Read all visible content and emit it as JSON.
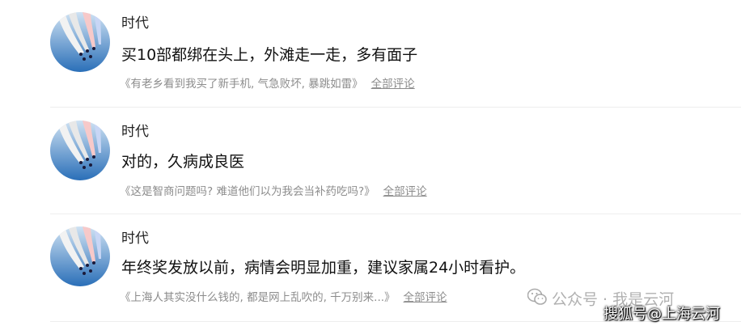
{
  "comments": [
    {
      "author": "时代",
      "content": "买10部都绑在头上，外滩走一走，多有面子",
      "source_title": "《有老乡看到我买了新手机, 气急败坏, 暴跳如雷》",
      "all_comments_label": "全部评论"
    },
    {
      "author": "时代",
      "content": "对的，久病成良医",
      "source_title": "《这是智商问题吗? 难道他们以为我会当补药吃吗?》",
      "all_comments_label": "全部评论"
    },
    {
      "author": "时代",
      "content": "年终奖发放以前，病情会明显加重，建议家属24小时看护。",
      "source_title": "《上海人其实没什么钱的, 都是网上乱吹的, 千万别来...》",
      "all_comments_label": "全部评论"
    }
  ],
  "watermark": {
    "wechat_text": "公众号 · 我是云河",
    "sohu_text": "搜狐号@上海云河",
    "wechat_icon": "wechat-icon"
  },
  "colors": {
    "author": "#222222",
    "content": "#111111",
    "source": "#8c8c8c",
    "divider": "#eeeeee"
  }
}
